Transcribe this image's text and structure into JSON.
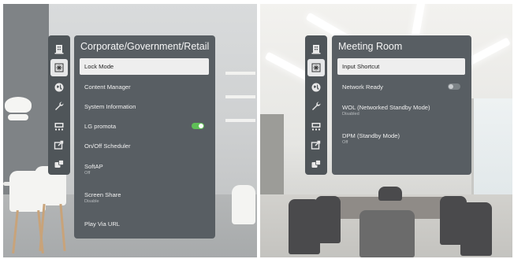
{
  "colors": {
    "panel_bg": "#585e63",
    "sidebar_bg": "#4f5559",
    "highlight_bg": "#eeeeee",
    "toggle_on": "#5fbf57",
    "toggle_off": "#7c8286"
  },
  "left_screen": {
    "sidebar_icons": [
      {
        "icon": "building-icon"
      },
      {
        "icon": "snowflake-icon",
        "active": true
      },
      {
        "icon": "globe-icon"
      },
      {
        "icon": "wrench-icon"
      },
      {
        "icon": "monitor-network-icon"
      },
      {
        "icon": "share-screen-icon"
      },
      {
        "icon": "devices-icon"
      }
    ],
    "menu": {
      "title": "Corporate/Government/Retail",
      "items": [
        {
          "label": "Lock Mode",
          "highlighted": true
        },
        {
          "label": "Content Manager"
        },
        {
          "label": "System Information"
        },
        {
          "label": "LG promota",
          "toggle": "on"
        },
        {
          "label": "On/Off Scheduler"
        },
        {
          "label": "SoftAP",
          "sub": "Off"
        },
        {
          "label": "Screen Share",
          "sub": "Disable"
        },
        {
          "label": "Play Via URL"
        }
      ]
    }
  },
  "right_screen": {
    "sidebar_icons": [
      {
        "icon": "building-icon"
      },
      {
        "icon": "snowflake-icon",
        "active": true
      },
      {
        "icon": "globe-icon"
      },
      {
        "icon": "wrench-icon"
      },
      {
        "icon": "monitor-network-icon"
      },
      {
        "icon": "share-screen-icon"
      },
      {
        "icon": "devices-icon"
      }
    ],
    "menu": {
      "title": "Meeting Room",
      "items": [
        {
          "label": "Input Shortcut",
          "highlighted": true
        },
        {
          "label": "Network Ready",
          "toggle": "off"
        },
        {
          "label": "WOL (Networked Standby Mode)",
          "sub": "Disabled"
        },
        {
          "label": "DPM (Standby Mode)",
          "sub": "Off"
        }
      ]
    }
  }
}
